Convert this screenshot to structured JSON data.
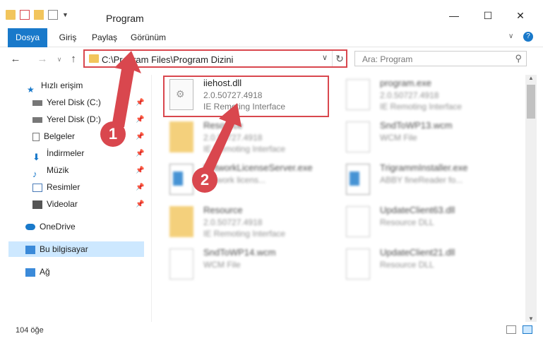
{
  "window": {
    "title": "Program",
    "minimize": "—",
    "maximize": "☐",
    "close": "✕"
  },
  "ribbon": {
    "tabs": [
      "Dosya",
      "Giriş",
      "Paylaş",
      "Görünüm"
    ]
  },
  "address": {
    "path": "C:\\Program Files\\Program Dizini"
  },
  "search": {
    "placeholder": "Ara: Program"
  },
  "sidebar": {
    "items": [
      {
        "label": "Hızlı erişim"
      },
      {
        "label": "Yerel Disk (C:)"
      },
      {
        "label": "Yerel Disk (D:)"
      },
      {
        "label": "Belgeler"
      },
      {
        "label": "İndirmeler"
      },
      {
        "label": "Müzik"
      },
      {
        "label": "Resimler"
      },
      {
        "label": "Videolar"
      },
      {
        "label": "OneDrive"
      },
      {
        "label": "Bu bilgisayar"
      },
      {
        "label": "Ağ"
      }
    ]
  },
  "files": [
    {
      "name": "iiehost.dll",
      "sub1": "2.0.50727.4918",
      "sub2": "IE Remoting Interface"
    },
    {
      "name": "program.exe",
      "sub1": "2.0.50727.4918",
      "sub2": "IE Remoting Interface"
    },
    {
      "name": "Resource",
      "sub1": "2.0.50727.4918",
      "sub2": "IE Remoting Interface"
    },
    {
      "name": "SndToWP13.wcm",
      "sub1": "WCM File",
      "sub2": ""
    },
    {
      "name": "NetworkLicenseServer.exe",
      "sub1": "Network licens...",
      "sub2": ""
    },
    {
      "name": "TrigrammInstaller.exe",
      "sub1": "ABBY fineReader fo...",
      "sub2": ""
    },
    {
      "name": "Resource",
      "sub1": "2.0.50727.4918",
      "sub2": "IE Remoting Interface"
    },
    {
      "name": "UpdateClient63.dll",
      "sub1": "Resource DLL",
      "sub2": ""
    },
    {
      "name": "SndToWP14.wcm",
      "sub1": "WCM File",
      "sub2": ""
    },
    {
      "name": "UpdateClient21.dll",
      "sub1": "Resource DLL",
      "sub2": ""
    }
  ],
  "status": {
    "count": "104 öğe"
  },
  "callouts": [
    "1",
    "2"
  ]
}
